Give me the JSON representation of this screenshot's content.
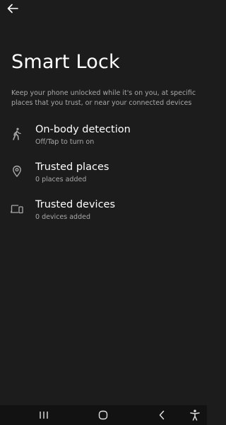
{
  "header": {
    "back_icon": "arrow-back-icon"
  },
  "page": {
    "title": "Smart Lock",
    "description": "Keep your phone unlocked while it's on you, at specific places that you trust, or near your connected devices"
  },
  "items": [
    {
      "icon": "walking-person-icon",
      "title": "On-body detection",
      "subtitle": "Off/Tap to turn on"
    },
    {
      "icon": "location-pin-icon",
      "title": "Trusted places",
      "subtitle": "0 places added"
    },
    {
      "icon": "devices-icon",
      "title": "Trusted devices",
      "subtitle": "0 devices added"
    }
  ],
  "navbar": {
    "recents_icon": "recents-icon",
    "home_icon": "home-icon",
    "back_icon": "back-chevron-icon",
    "accessibility_icon": "accessibility-icon"
  },
  "colors": {
    "background": "#1c1c1c",
    "text_primary": "#ffffff",
    "text_secondary": "#a9a9a9",
    "navbar": "#121212"
  }
}
